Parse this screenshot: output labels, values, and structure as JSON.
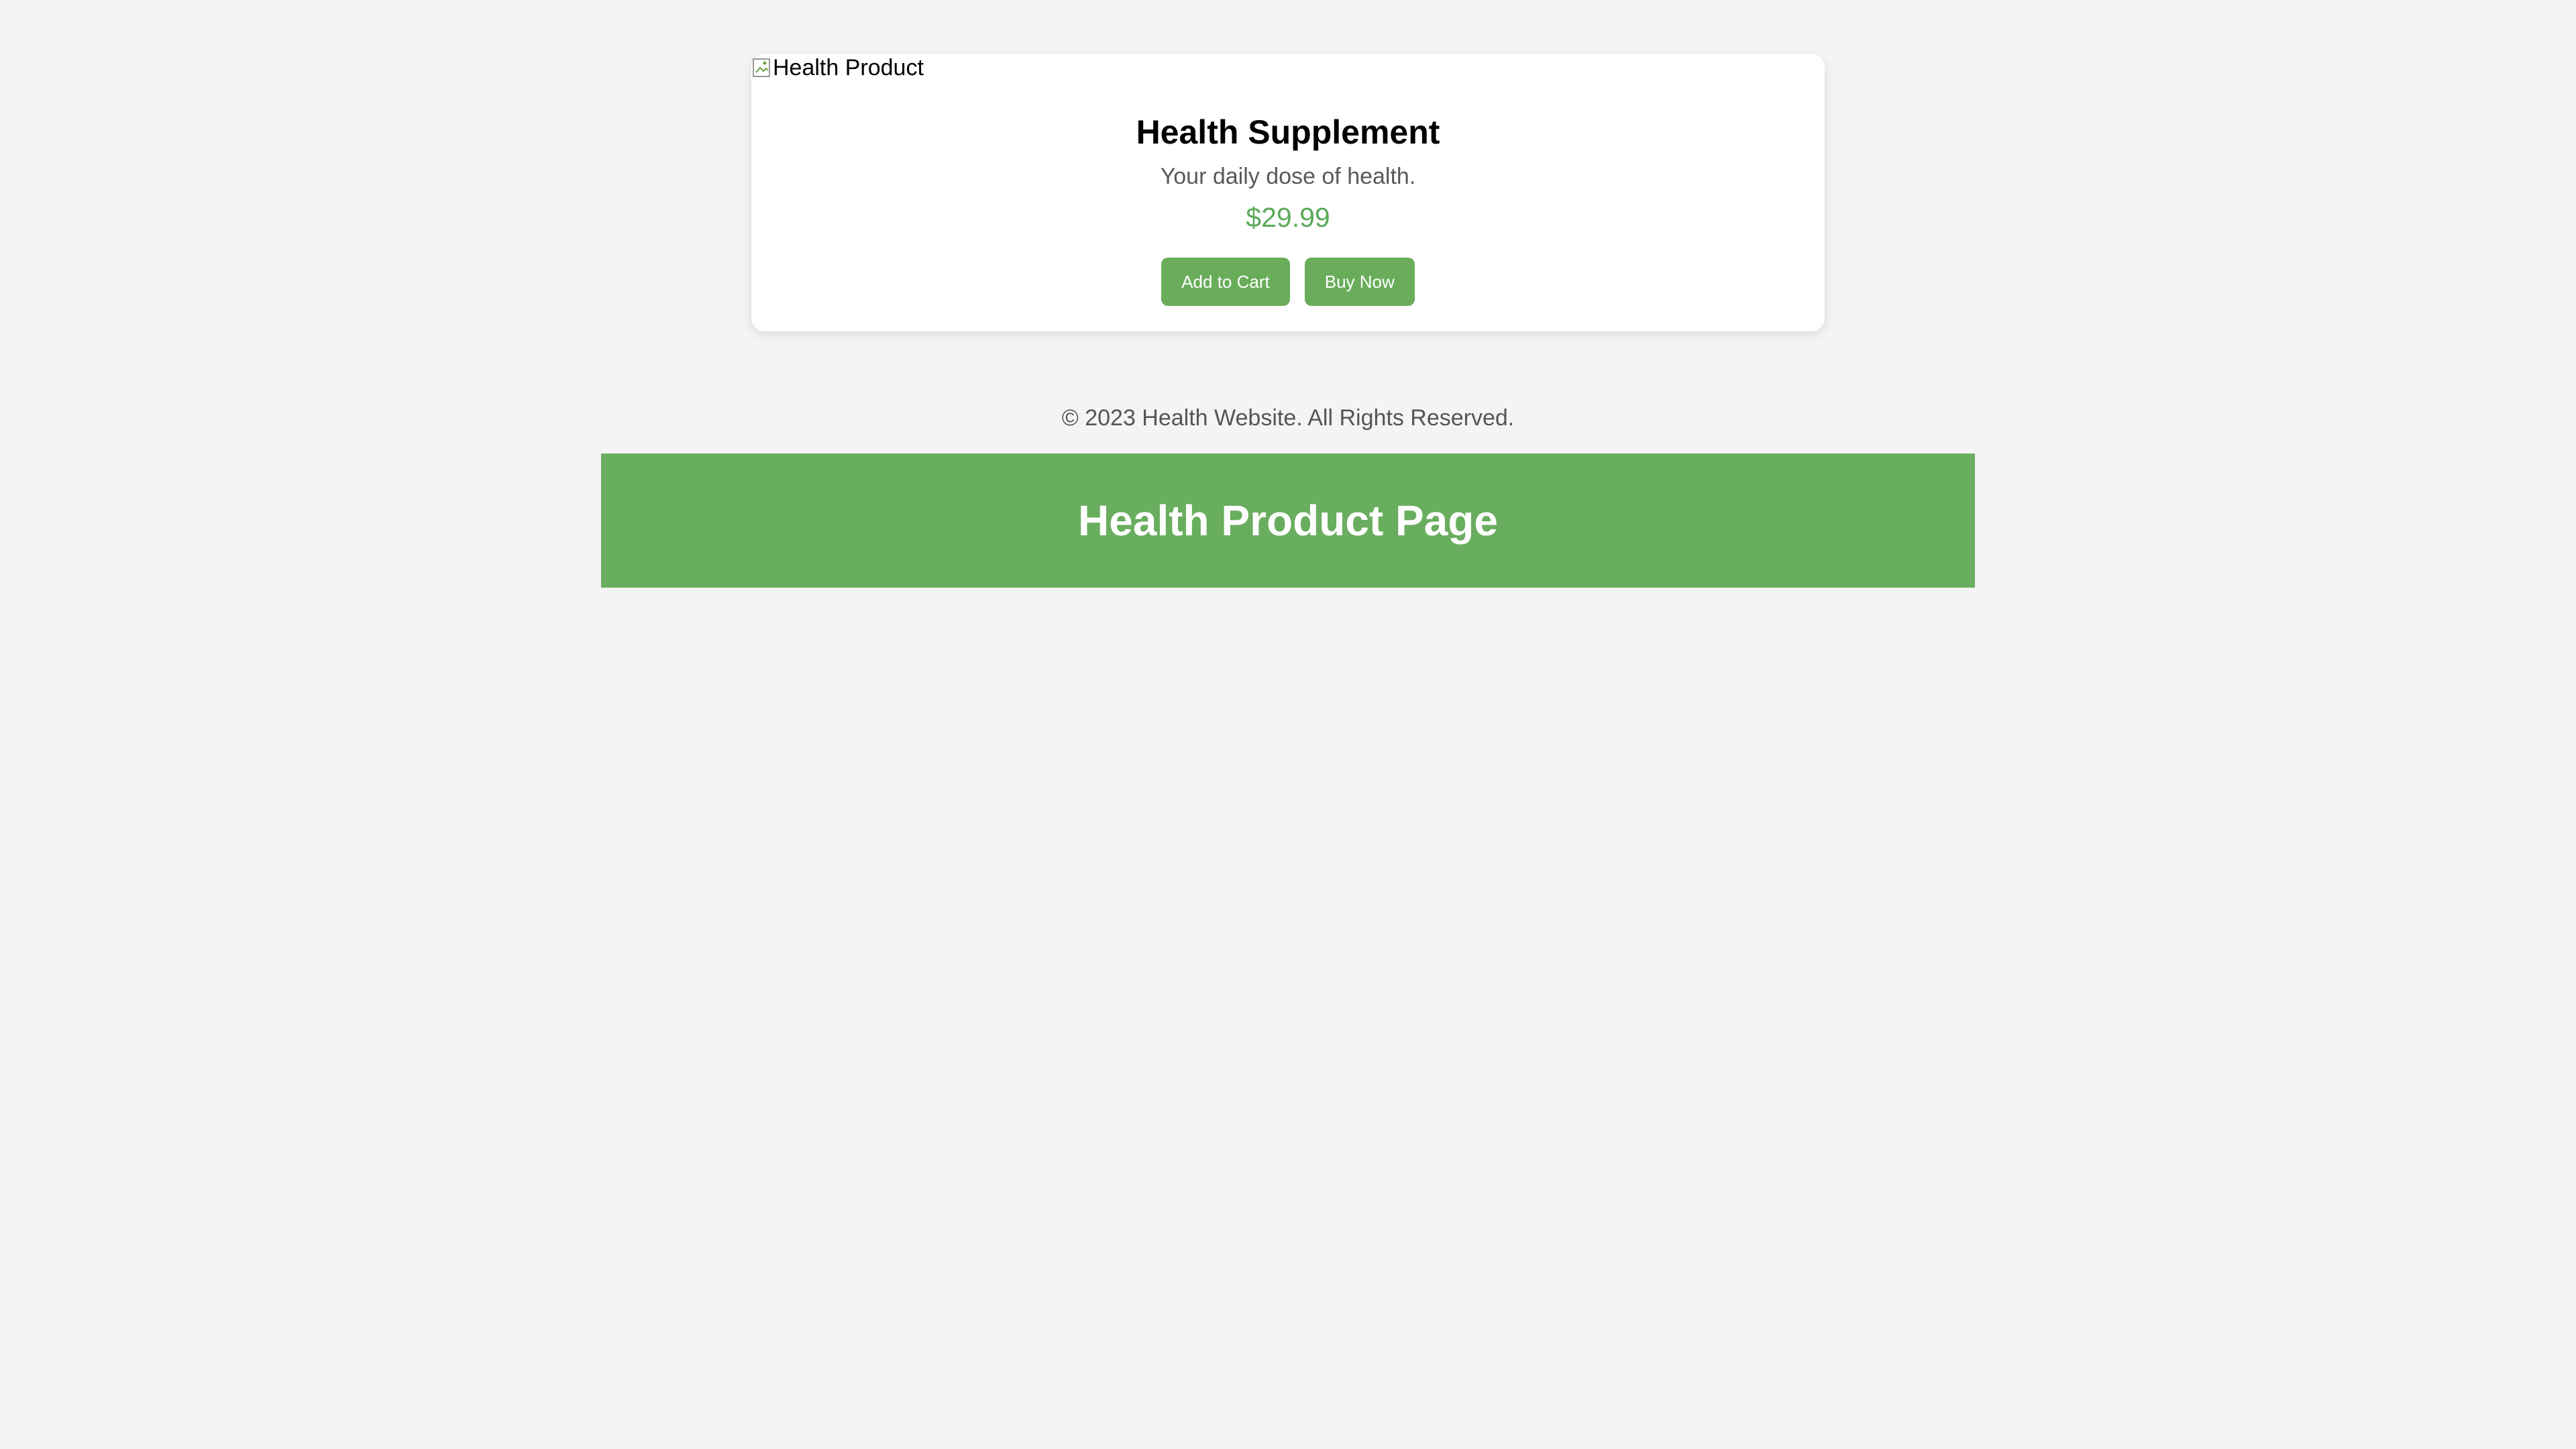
{
  "product": {
    "image_alt": "Health Product",
    "title": "Health Supplement",
    "description": "Your daily dose of health.",
    "price": "$29.99",
    "add_to_cart_label": "Add to Cart",
    "buy_now_label": "Buy Now"
  },
  "footer": {
    "copyright": "© 2023 Health Website. All Rights Reserved."
  },
  "banner": {
    "title": "Health Product Page"
  },
  "colors": {
    "background": "#f4f4f4",
    "accent_green": "#69ad5b",
    "price_green": "#5aa95a"
  },
  "icons": {
    "broken_image": "broken-image-icon"
  }
}
